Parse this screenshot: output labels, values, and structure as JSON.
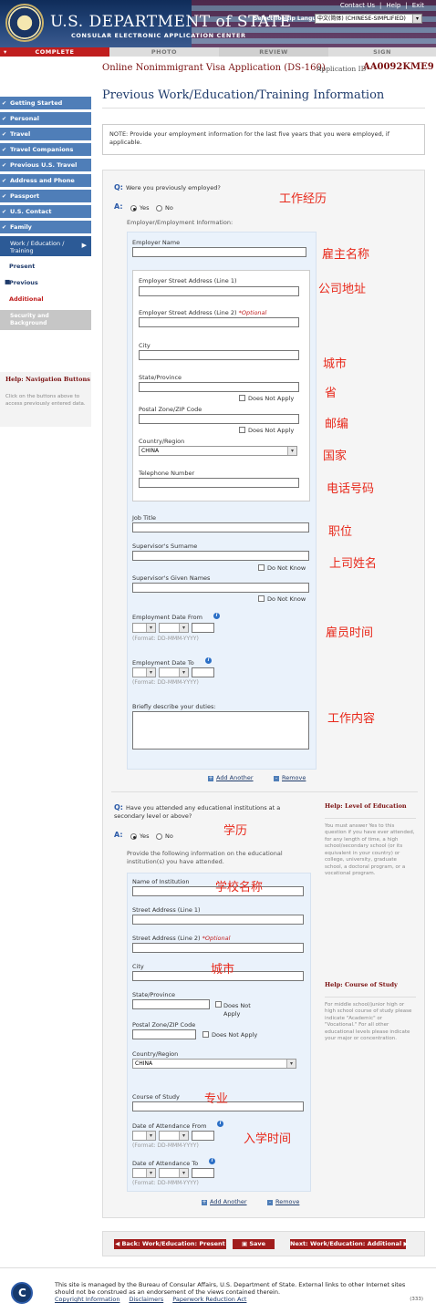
{
  "header": {
    "title_main": "U.S. DEPARTMENT of STATE",
    "title_sub": "CONSULAR ELECTRONIC APPLICATION CENTER",
    "links": [
      "Contact Us",
      "Help",
      "Exit"
    ],
    "language_label": "Select Tooltip Language",
    "language_value": "中文(简体) (CHINESE-SIMPLIFIED)"
  },
  "steps": [
    "COMPLETE",
    "PHOTO",
    "REVIEW",
    "SIGN"
  ],
  "app": {
    "title": "Online Nonimmigrant Visa Application (DS-160)",
    "id_label": "Application ID",
    "id_value": "AA0092KME9"
  },
  "page_title": "Previous Work/Education/Training Information",
  "note": "NOTE: Provide your employment information for the last five years that you were employed, if applicable.",
  "sidebar": {
    "items": [
      "Getting Started",
      "Personal",
      "Travel",
      "Travel Companions",
      "Previous U.S. Travel",
      "Address and Phone",
      "Passport",
      "U.S. Contact",
      "Family"
    ],
    "section": "Work / Education / Training",
    "sub_present": "Present",
    "sub_previous": "Previous",
    "sub_additional": "Additional",
    "security": "Security and Background",
    "help_title": "Help: Navigation Buttons",
    "help_text": "Click on the buttons above to access previously entered data."
  },
  "employment": {
    "question": "Were you previously employed?",
    "yes": "Yes",
    "no": "No",
    "sub_label": "Employer/Employment Information:",
    "employer_name": "Employer Name",
    "street1": "Employer Street Address (Line 1)",
    "street2": "Employer Street Address (Line 2)",
    "optional": "*Optional",
    "city": "City",
    "state": "State/Province",
    "dna": "Does Not Apply",
    "zip": "Postal Zone/ZIP Code",
    "country": "Country/Region",
    "country_value": "CHINA",
    "phone": "Telephone Number",
    "job_title": "Job Title",
    "sup_surname": "Supervisor's Surname",
    "dnk": "Do Not Know",
    "sup_given": "Supervisor's Given Names",
    "date_from": "Employment Date From",
    "date_to": "Employment Date To",
    "format": "(Format: DD-MMM-YYYY)",
    "duties": "Briefly describe your duties:",
    "add": "Add Another",
    "remove": "Remove"
  },
  "education": {
    "question": "Have you attended any educational institutions at a secondary level or above?",
    "yes": "Yes",
    "no": "No",
    "sub_label": "Provide the following information on the educational institution(s) you have attended.",
    "name": "Name of Institution",
    "street1": "Street Address (Line 1)",
    "street2": "Street Address (Line 2)",
    "optional": "*Optional",
    "city": "City",
    "state": "State/Province",
    "dna": "Does Not Apply",
    "zip": "Postal Zone/ZIP Code",
    "country": "Country/Region",
    "country_value": "CHINA",
    "course": "Course of Study",
    "date_from": "Date of Attendance From",
    "date_to": "Date of Attendance To",
    "format": "(Format: DD-MMM-YYYY)",
    "add": "Add Another",
    "remove": "Remove"
  },
  "help_level": {
    "title": "Help: Level of Education",
    "text": "You must answer Yes to this question if you have ever attended, for any length of time, a high school/secondary school (or its equivalent in your country) or college, university, graduate school, a doctoral program, or a vocational program."
  },
  "help_study": {
    "title": "Help: Course of Study",
    "text": "For middle school/junior high or high school course of study please indicate \"Academic\" or \"Vocational.\" For all other educational levels please indicate your major or concentration."
  },
  "annotations": {
    "work_history": "工作经历",
    "employer_name": "雇主名称",
    "company_address": "公司地址",
    "city": "城市",
    "province": "省",
    "postcode": "邮编",
    "country": "国家",
    "phone": "电话号码",
    "job_title": "职位",
    "supervisor_name": "上司姓名",
    "employment_time": "雇员时间",
    "job_content": "工作内容",
    "education": "学历",
    "school_name": "学校名称",
    "city2": "城市",
    "major": "专业",
    "enrollment_time": "入学时间"
  },
  "buttons": {
    "back": "Back: Work/Education: Present",
    "save": "Save",
    "next": "Next: Work/Education: Additional"
  },
  "footer": {
    "text": "This site is managed by the Bureau of Consular Affairs, U.S. Department of State. External links to other Internet sites should not be construed as an endorsement of the views contained therein.",
    "links": [
      "Copyright Information",
      "Disclaimers",
      "Paperwork Reduction Act"
    ],
    "code": "(333)"
  },
  "colors": {
    "brand_red": "#c01e1e",
    "nav_blue": "#4f7eb8",
    "annotation_red": "#e8291b"
  }
}
